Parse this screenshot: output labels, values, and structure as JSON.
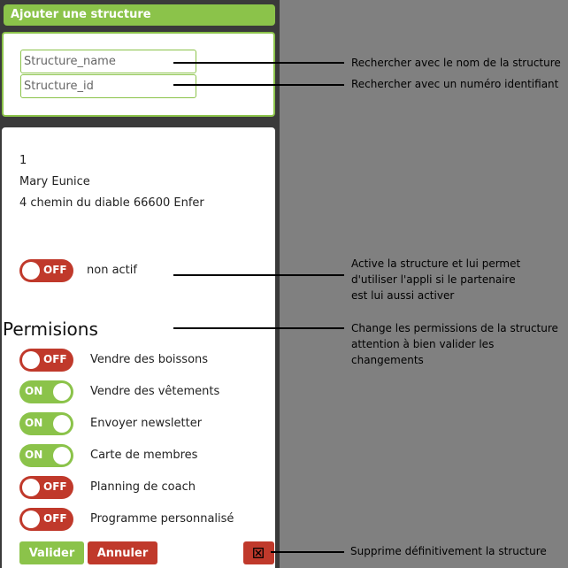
{
  "header": {
    "title": "Ajouter une structure"
  },
  "search": {
    "name_placeholder": "Structure_name",
    "id_placeholder": "Structure_id"
  },
  "structure": {
    "id": "1",
    "name": "Mary Eunice",
    "address": "4 chemin du diable 66600 Enfer"
  },
  "status": {
    "toggle": "OFF",
    "label": "non actif"
  },
  "permissions": {
    "title": "Permisions",
    "items": [
      {
        "label": "Vendre des boissons",
        "state": "OFF"
      },
      {
        "label": "Vendre des vêtements",
        "state": "ON"
      },
      {
        "label": "Envoyer newsletter",
        "state": "ON"
      },
      {
        "label": "Carte de membres",
        "state": "ON"
      },
      {
        "label": "Planning de coach",
        "state": "OFF"
      },
      {
        "label": "Programme personnalisé",
        "state": "OFF"
      }
    ]
  },
  "actions": {
    "validate": "Valider",
    "cancel": "Annuler"
  },
  "annotations": {
    "search_name": "Rechercher avec le nom de la structure",
    "search_id": "Rechercher avec un numéro identifiant",
    "activate": [
      "Active la structure et lui permet",
      "d'utiliser l'appli si le partenaire",
      "est lui aussi activer"
    ],
    "permissions": [
      "Change les permissions de la structure",
      "attention à bien valider les changements"
    ],
    "delete": "Supprime définitivement la structure"
  },
  "colors": {
    "accent": "#8bc34a",
    "danger": "#c0392b",
    "background": "#808080"
  },
  "icons": {
    "delete": "trash-icon"
  }
}
